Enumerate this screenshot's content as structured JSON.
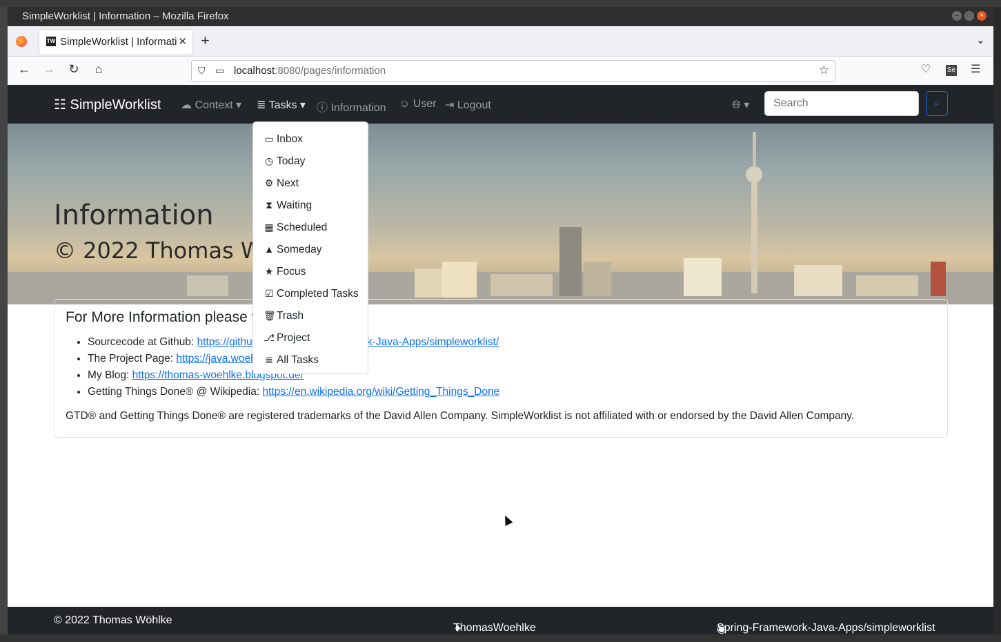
{
  "window": {
    "title": "SimpleWorklist | Information – Mozilla Firefox"
  },
  "browser": {
    "tab_title": "SimpleWorklist | Information",
    "tab_favicon": "TW",
    "url_host": "localhost",
    "url_path": ":8080/pages/information"
  },
  "app_nav": {
    "brand": "SimpleWorklist",
    "context": "Context",
    "tasks": "Tasks",
    "information": "Information",
    "user": "User",
    "logout": "Logout",
    "search_placeholder": "Search"
  },
  "hero": {
    "title": "Information",
    "subtitle": "© 2022 Thomas Wöhlke"
  },
  "tasks_menu": {
    "items": [
      "Inbox",
      "Today",
      "Next",
      "Waiting",
      "Scheduled",
      "Someday",
      "Focus",
      "Completed Tasks",
      "Trash",
      "Project",
      "All Tasks"
    ]
  },
  "card": {
    "heading": "For More Information please visit:",
    "links": [
      {
        "label": "Sourcecode at Github:",
        "url": "https://github.com/Spring-Framework-Java-Apps/simpleworklist/"
      },
      {
        "label": "The Project Page:",
        "url": "https://java.woehlke.org/simpleworklist/"
      },
      {
        "label": "My Blog:",
        "url": "https://thomas-woehlke.blogspot.de/"
      },
      {
        "label": "Getting Things Done® @ Wikipedia:",
        "url": "https://en.wikipedia.org/wiki/Getting_Things_Done"
      }
    ],
    "disclaimer": "GTD® and Getting Things Done® are registered trademarks of the David Allen Company. SimpleWorklist is not affiliated with or endorsed by the David Allen Company."
  },
  "footer": {
    "copyright": "© 2022 Thomas Wöhlke",
    "twitter": "ThomasWoehlke",
    "github": "Spring-Framework-Java-Apps/simpleworklist"
  },
  "colors": {
    "navbar": "#212529",
    "link": "#0d6efd"
  }
}
